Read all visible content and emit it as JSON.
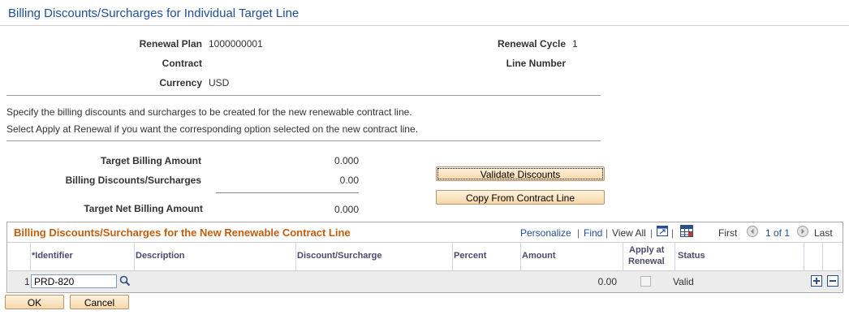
{
  "page": {
    "title": "Billing Discounts/Surcharges for Individual Target Line"
  },
  "header": {
    "renewal_plan_label": "Renewal Plan",
    "renewal_plan_value": "1000000001",
    "renewal_cycle_label": "Renewal Cycle",
    "renewal_cycle_value": "1",
    "contract_label": "Contract",
    "line_number_label": "Line Number",
    "currency_label": "Currency",
    "currency_value": "USD"
  },
  "instructions": {
    "line1": "Specify the billing discounts and surcharges to be created for the new renewable contract line.",
    "line2": "Select Apply at Renewal if you want the corresponding option selected on the new contract line."
  },
  "amounts": {
    "target_billing_label": "Target Billing Amount",
    "target_billing_value": "0.000",
    "discounts_label": "Billing Discounts/Surcharges",
    "discounts_value": "0.00",
    "target_net_label": "Target Net Billing Amount",
    "target_net_value": "0.000"
  },
  "buttons": {
    "validate_discounts": "Validate Discounts",
    "copy_from_contract_line": "Copy From Contract Line",
    "ok": "OK",
    "cancel": "Cancel"
  },
  "grid": {
    "title": "Billing Discounts/Surcharges for the New Renewable Contract Line",
    "personalize": "Personalize",
    "find": "Find",
    "view_all": "View All",
    "first": "First",
    "page_info": "1 of 1",
    "last": "Last",
    "columns": {
      "identifier": "*Identifier",
      "description": "Description",
      "discount_surcharge": "Discount/Surcharge",
      "percent": "Percent",
      "amount": "Amount",
      "apply_at_renewal_1": "Apply at",
      "apply_at_renewal_2": "Renewal",
      "status": "Status"
    },
    "rows": [
      {
        "num": "1",
        "identifier": "PRD-820",
        "amount": "0.00",
        "apply_at_renewal": false,
        "status": "Valid"
      }
    ]
  },
  "colors": {
    "title_blue": "#1f4e96",
    "grid_title_orange": "#c15e0f"
  }
}
